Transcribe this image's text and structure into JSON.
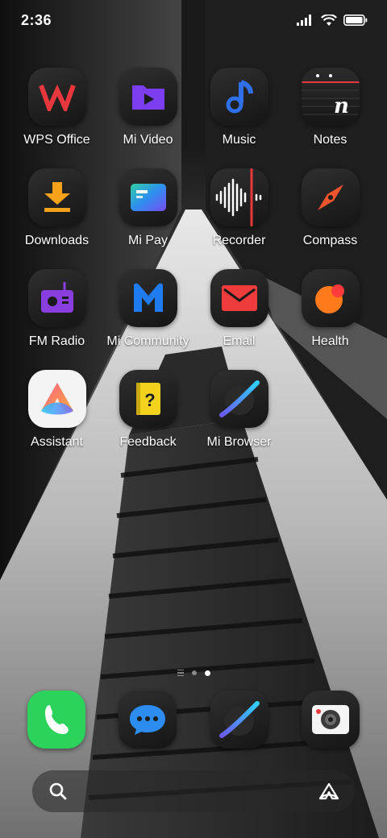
{
  "status_bar": {
    "time": "2:36",
    "icons": [
      "signal-icon",
      "wifi-icon",
      "battery-icon"
    ]
  },
  "apps": [
    {
      "label": "WPS Office",
      "icon": "wps-office-icon"
    },
    {
      "label": "Mi Video",
      "icon": "mi-video-icon"
    },
    {
      "label": "Music",
      "icon": "music-icon"
    },
    {
      "label": "Notes",
      "icon": "notes-icon"
    },
    {
      "label": "Downloads",
      "icon": "downloads-icon"
    },
    {
      "label": "Mi Pay",
      "icon": "mi-pay-icon"
    },
    {
      "label": "Recorder",
      "icon": "recorder-icon"
    },
    {
      "label": "Compass",
      "icon": "compass-icon"
    },
    {
      "label": "FM Radio",
      "icon": "fm-radio-icon"
    },
    {
      "label": "Mi Community",
      "icon": "mi-community-icon"
    },
    {
      "label": "Email",
      "icon": "email-icon"
    },
    {
      "label": "Health",
      "icon": "health-icon"
    },
    {
      "label": "Assistant",
      "icon": "assistant-icon"
    },
    {
      "label": "Feedback",
      "icon": "feedback-icon"
    },
    {
      "label": "Mi Browser",
      "icon": "mi-browser-icon"
    }
  ],
  "page_indicator": {
    "pages": 2,
    "active": 1
  },
  "dock": [
    {
      "icon": "phone-icon"
    },
    {
      "icon": "messages-icon"
    },
    {
      "icon": "browser-icon"
    },
    {
      "icon": "camera-icon"
    }
  ],
  "search_bar": {
    "left_icon": "search-icon",
    "right_icon": "assistant-icon"
  },
  "colors": {
    "wps_red": "#e8383d",
    "mi_video_purple": "#7b3df0",
    "music_blue": "#2f6fe8",
    "downloads_orange": "#f7a21b",
    "compass_red": "#f0542c",
    "fm_radio_purple": "#8a3ee0",
    "mi_blue": "#1f7cf0",
    "email_red": "#ef3b3b",
    "health_orange": "#ff7a1a",
    "feedback_yellow": "#f2d21c",
    "phone_green": "#2bd25b",
    "messages_blue": "#2d8cf0"
  }
}
